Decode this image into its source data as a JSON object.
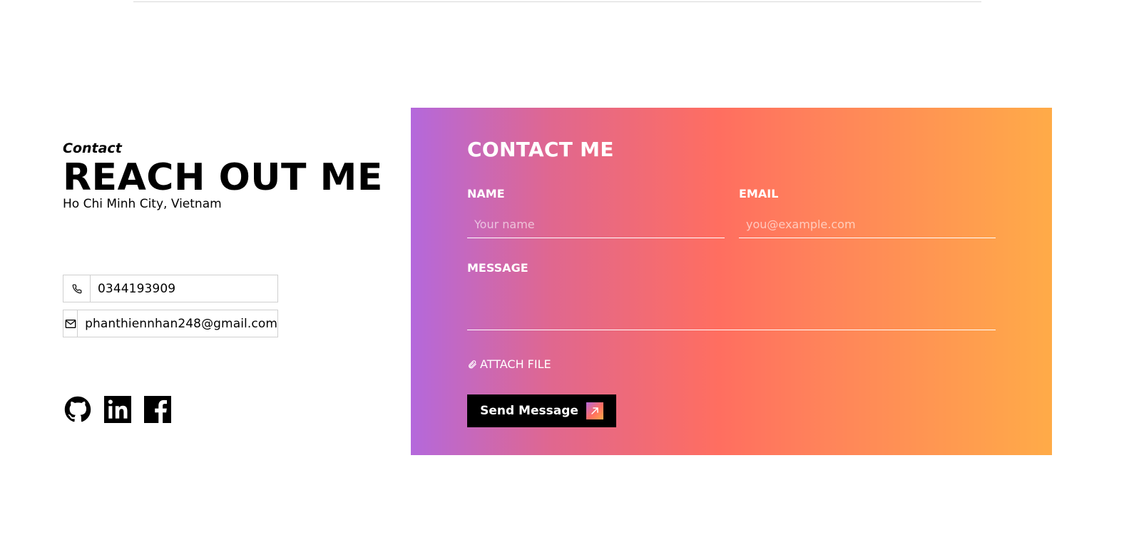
{
  "left": {
    "eyebrow": "Contact",
    "headline": "REACH OUT ME",
    "location": "Ho Chi Minh City, Vietnam",
    "phone": "0344193909",
    "email": "phanthiennhan248@gmail.com",
    "socials": [
      {
        "icon": "github-icon"
      },
      {
        "icon": "linkedin-icon"
      },
      {
        "icon": "facebook-icon"
      }
    ]
  },
  "form": {
    "title": "CONTACT ME",
    "name_label": "NAME",
    "name_placeholder": "Your name",
    "name_value": "",
    "email_label": "EMAIL",
    "email_placeholder": "you@example.com",
    "email_value": "",
    "message_label": "MESSAGE",
    "message_value": "",
    "attach_label": "ATTACH FILE",
    "send_label": "Send Message",
    "gradient_colors": [
      "#b468dc",
      "#ff6e60",
      "#ffab48"
    ]
  }
}
